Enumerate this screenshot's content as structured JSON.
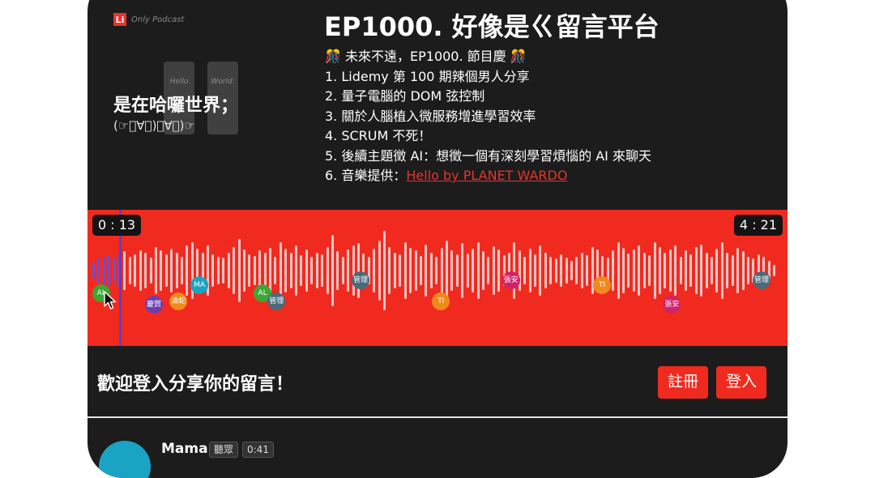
{
  "cover": {
    "logo_letter": "Li",
    "logo_text": "Only Podcast",
    "card_words": [
      "Hello",
      "World."
    ],
    "title": "是在哈囉世界；",
    "kaomoji": "(☞ﾟ∀ﾟ)ﾟ∀ﾟ)☞"
  },
  "episode": {
    "title": "EP1000. 好像是ㄍ留言平台",
    "description": [
      "🎊 未來不遠，EP1000. 節目慶 🎊",
      "1. Lidemy 第 100 期辣個男人分享",
      "2. 量子電腦的 DOM 弦控制",
      "3. 關於人腦植入微服務增進學習效率",
      "4. SCRUM 不死！",
      "5. 後續主題徵 AI：想徵一個有深刻學習煩惱的 AI 來聊天"
    ],
    "music_label": "6. 音樂提供：",
    "music_link": "Hello by PLANET WARDO"
  },
  "player": {
    "current_time": "0 : 13",
    "total_time": "4 : 21",
    "progress": 0.05,
    "colors": {
      "wave_bg": "#f12a1f",
      "bar": "#f3c6c4",
      "played_bar": "#6a4fd8"
    },
    "bar_heights": [
      0.18,
      0.28,
      0.3,
      0.34,
      0.26,
      0.38,
      0.42,
      0.3,
      0.36,
      0.45,
      0.4,
      0.28,
      0.52,
      0.44,
      0.36,
      0.48,
      0.4,
      0.3,
      0.55,
      0.62,
      0.48,
      0.4,
      0.56,
      0.35,
      0.3,
      0.28,
      0.4,
      0.52,
      0.7,
      0.46,
      0.36,
      0.32,
      0.44,
      0.4,
      0.5,
      0.3,
      0.62,
      0.48,
      0.4,
      0.56,
      0.34,
      0.46,
      0.3,
      0.4,
      0.36,
      0.52,
      0.78,
      0.42,
      0.3,
      0.46,
      0.56,
      0.6,
      0.38,
      0.3,
      0.48,
      0.66,
      0.88,
      0.52,
      0.4,
      0.36,
      0.62,
      0.5,
      0.44,
      0.32,
      0.58,
      0.4,
      0.3,
      0.5,
      0.66,
      0.44,
      0.36,
      0.6,
      0.38,
      0.48,
      0.62,
      0.42,
      0.3,
      0.54,
      0.46,
      0.34,
      0.4,
      0.62,
      0.44,
      0.3,
      0.48,
      0.36,
      0.56,
      0.4,
      0.3,
      0.26,
      0.36,
      0.28,
      0.22,
      0.3,
      0.4,
      0.34,
      0.52,
      0.46,
      0.32,
      0.28,
      0.44,
      0.62,
      0.5,
      0.38,
      0.46,
      0.56,
      0.4,
      0.34,
      0.62,
      0.52,
      0.4,
      0.46,
      0.56,
      0.3,
      0.44,
      0.36,
      0.52,
      0.58,
      0.4,
      0.3,
      0.48,
      0.62,
      0.4,
      0.34,
      0.5,
      0.42,
      0.3,
      0.26,
      0.36,
      0.3,
      0.22,
      0.12
    ],
    "commenters": [
      {
        "label": "AL",
        "color": "#3fa535",
        "pos": 0.02,
        "row": 0
      },
      {
        "label": "慶賀",
        "color": "#6a3fb0",
        "pos": 0.095,
        "row": 2
      },
      {
        "label": "油蛇",
        "color": "#f08a1c",
        "pos": 0.13,
        "row": 1
      },
      {
        "label": "MA",
        "color": "#1aa4c4",
        "pos": 0.16,
        "row": -1
      },
      {
        "label": "AL",
        "color": "#3fa535",
        "pos": 0.25,
        "row": 0
      },
      {
        "label": "管理",
        "color": "#4a6a7a",
        "pos": 0.27,
        "row": 1
      },
      {
        "label": "管理",
        "color": "#4a6a7a",
        "pos": 0.39,
        "row": -2
      },
      {
        "label": "TI",
        "color": "#f08a1c",
        "pos": 0.505,
        "row": 1
      },
      {
        "label": "張安",
        "color": "#d0226a",
        "pos": 0.605,
        "row": -2
      },
      {
        "label": "TI",
        "color": "#f08a1c",
        "pos": 0.735,
        "row": -1
      },
      {
        "label": "張安",
        "color": "#d0226a",
        "pos": 0.835,
        "row": 2
      },
      {
        "label": "管理",
        "color": "#4a6a7a",
        "pos": 0.963,
        "row": -2
      }
    ]
  },
  "login": {
    "prompt": "歡迎登入分享你的留言！",
    "register_label": "註冊",
    "login_label": "登入"
  },
  "comment": {
    "name": "Mama",
    "role": "聽眾",
    "time": "0:41"
  }
}
